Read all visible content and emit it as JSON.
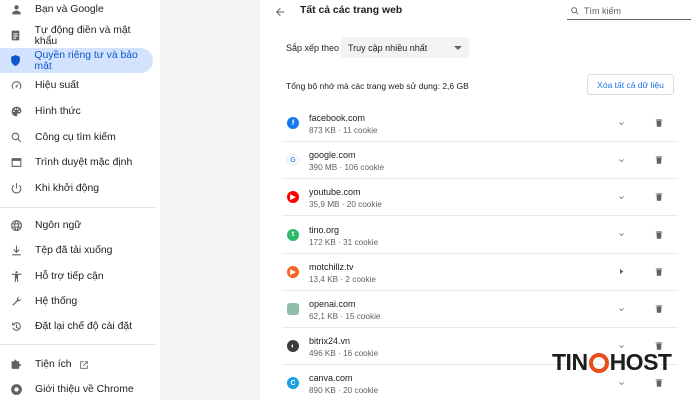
{
  "sidebar": {
    "items": [
      {
        "label": "Bạn và Google",
        "icon": "person-icon"
      },
      {
        "label": "Tự động điền và mật khẩu",
        "icon": "clipboard-icon"
      },
      {
        "label": "Quyền riêng tư và bảo mật",
        "icon": "shield-icon",
        "active": true
      },
      {
        "label": "Hiệu suất",
        "icon": "speedometer-icon"
      },
      {
        "label": "Hình thức",
        "icon": "palette-icon"
      },
      {
        "label": "Công cụ tìm kiếm",
        "icon": "search-icon"
      },
      {
        "label": "Trình duyệt mặc định",
        "icon": "browser-icon"
      },
      {
        "label": "Khi khởi động",
        "icon": "power-icon"
      },
      {
        "label": "Ngôn ngữ",
        "icon": "globe-icon"
      },
      {
        "label": "Tệp đã tải xuống",
        "icon": "download-icon"
      },
      {
        "label": "Hỗ trợ tiếp cận",
        "icon": "accessibility-icon"
      },
      {
        "label": "Hệ thống",
        "icon": "wrench-icon"
      },
      {
        "label": "Đặt lại chế độ cài đặt",
        "icon": "reset-icon"
      },
      {
        "label": "Tiện ích",
        "icon": "puzzle-icon"
      },
      {
        "label": "Giới thiệu về Chrome",
        "icon": "chrome-icon"
      }
    ]
  },
  "header": {
    "title": "Tất cả các trang web",
    "search_placeholder": "Tìm kiếm"
  },
  "sort": {
    "label": "Sắp xếp theo",
    "selected": "Truy cập nhiều nhất"
  },
  "storage": {
    "text": "Tổng bộ nhớ mà các trang web sử dụng: 2,6 GB",
    "clear_label": "Xóa tất cả dữ liệu"
  },
  "sites": [
    {
      "name": "facebook.com",
      "meta": "873 KB · 11 cookie",
      "favicon_color": "#1877f2",
      "favicon_text": "f"
    },
    {
      "name": "google.com",
      "meta": "390 MB · 106 cookie",
      "favicon_color": "#ffffff",
      "favicon_text": "G"
    },
    {
      "name": "youtube.com",
      "meta": "35,9 MB · 20 cookie",
      "favicon_color": "#ff0000",
      "favicon_text": "▶"
    },
    {
      "name": "tino.org",
      "meta": "172 KB · 31 cookie",
      "favicon_color": "#2fb86b",
      "favicon_text": "t"
    },
    {
      "name": "motchillz.tv",
      "meta": "13,4 KB · 2 cookie",
      "favicon_color": "#f26522",
      "favicon_text": "▶"
    },
    {
      "name": "openai.com",
      "meta": "62,1 KB · 15 cookie",
      "favicon_color": "#8fbfa8",
      "favicon_text": ""
    },
    {
      "name": "bitrix24.vn",
      "meta": "496 KB · 16 cookie",
      "favicon_color": "#3b3b3b",
      "favicon_text": "◐"
    },
    {
      "name": "canva.com",
      "meta": "890 KB · 20 cookie",
      "favicon_color": "#1a9ee3",
      "favicon_text": "C"
    }
  ],
  "watermark": {
    "text_before": "TIN",
    "text_after": "HOST"
  },
  "colors": {
    "accent": "#0b57d0",
    "active_bg": "#d3e3fd",
    "link": "#1a73e8"
  }
}
